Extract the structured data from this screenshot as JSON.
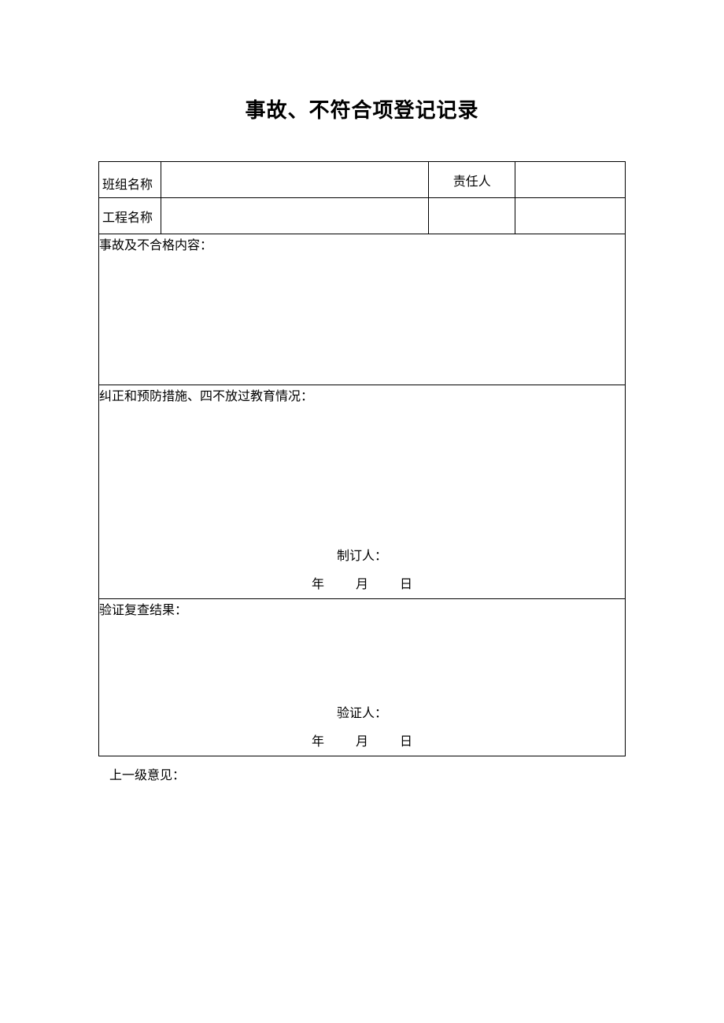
{
  "title": "事故、不符合项登记记录",
  "labels": {
    "team_name": "班组名称",
    "project_name": "工程名称",
    "responsible": "责任人",
    "accident_content": "事故及不合格内容：",
    "corrective_actions": "纠正和预防措施、四不放过教育情况：",
    "verify_result": "验证复查结果：",
    "superior_opinion": "上一级意见："
  },
  "signatures": {
    "drafter": "制订人：",
    "verifier": "验证人：",
    "date_year": "年",
    "date_month": "月",
    "date_day": "日"
  },
  "values": {
    "team_name": "",
    "project_name": "",
    "responsible_person": "",
    "row2_col3": "",
    "row2_col4": ""
  }
}
